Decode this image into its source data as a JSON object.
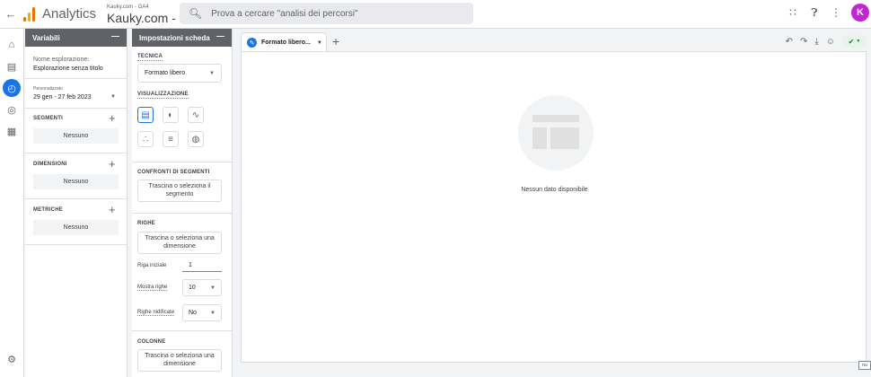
{
  "topbar": {
    "app_title": "Analytics",
    "account_small": "Kauky.com - GA4",
    "account_big": "Kauky.com - GA4",
    "search_placeholder": "Prova a cercare \"analisi dei percorsi\"",
    "avatar_letter": "K"
  },
  "variables": {
    "header": "Variabili",
    "name_label": "Nome esplorazione:",
    "name_value": "Esplorazione senza titolo",
    "date_small": "Personalizzato",
    "date_range": "29 gen - 27 feb 2023",
    "segments_title": "SEGMENTI",
    "segments_value": "Nessuno",
    "dimensions_title": "DIMENSIONI",
    "dimensions_value": "Nessuno",
    "metrics_title": "METRICHE",
    "metrics_value": "Nessuno"
  },
  "tab_settings": {
    "header": "Impostazioni scheda",
    "technique_title": "TECNICA",
    "technique_value": "Formato libero",
    "viz_title": "VISUALIZZAZIONE",
    "segment_compare_title": "CONFRONTI DI SEGMENTI",
    "segment_drop": "Trascina o seleziona il segmento",
    "rows_title": "RIGHE",
    "rows_drop": "Trascina o seleziona una dimensione",
    "start_row_label": "Riga iniziale",
    "start_row_value": "1",
    "show_rows_label": "Mostra righe",
    "show_rows_value": "10",
    "nested_rows_label": "Righe nidificate",
    "nested_rows_value": "No",
    "columns_title": "COLONNE",
    "columns_drop": "Trascina o seleziona una dimensione"
  },
  "main": {
    "tab_label": "Formato libero...",
    "empty_text": "Nessun dato disponibile",
    "corner_tag": "nu"
  },
  "colors": {
    "accent": "#1a73e8",
    "avatar": "#c026d3",
    "panel_header": "#5f6368"
  }
}
